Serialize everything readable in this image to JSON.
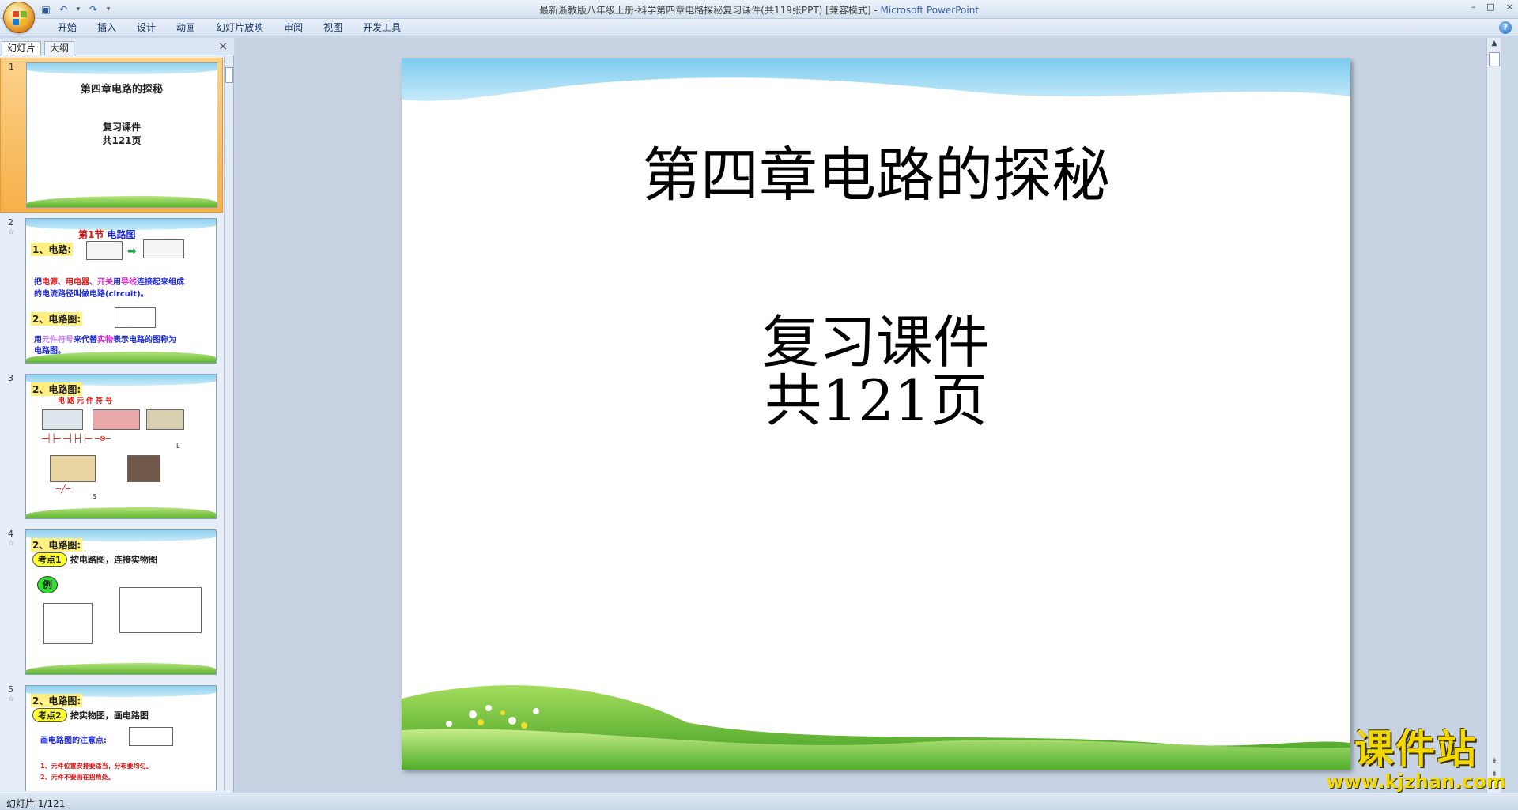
{
  "titlebar": {
    "title": "最新浙教版八年级上册-科学第四章电路探秘复习课件(共119张PPT) [兼容模式]",
    "app_name": "Microsoft PowerPoint",
    "window_controls": [
      "–",
      "□",
      "×"
    ]
  },
  "quick_access": {
    "icons": [
      "save-icon",
      "undo-icon",
      "redo-icon",
      "customize-icon"
    ]
  },
  "ribbon": {
    "tabs": [
      "开始",
      "插入",
      "设计",
      "动画",
      "幻灯片放映",
      "审阅",
      "视图",
      "开发工具"
    ],
    "help": "?"
  },
  "left_panel": {
    "tabs": [
      "幻灯片",
      "大纲"
    ],
    "close": "×"
  },
  "thumbnails": [
    {
      "num": "1",
      "lines": [
        "第四章电路的探秘",
        "复习课件",
        "共121页"
      ]
    },
    {
      "num": "2",
      "section": "第1节",
      "section_title": "电路图",
      "item1": "1、电路:",
      "def_parts": [
        "把",
        "电源",
        "、",
        "用电器",
        "、",
        "开关",
        "用",
        "导线",
        "连接起来组成"
      ],
      "def_line2": "的电流路径叫做电路(circuit)。",
      "item2": "2、电路图:",
      "desc_parts": [
        "用",
        "元件符号",
        "来代替",
        "实物",
        "表示电路的图称为"
      ],
      "desc_line2": "电路图。"
    },
    {
      "num": "3",
      "item": "2、电路图:",
      "subtitle": "电路元件符号",
      "label_l": "L",
      "label_s": "S"
    },
    {
      "num": "4",
      "item": "2、电路图:",
      "pill": "考点1",
      "pill_text": "按电路图，连接实物图",
      "example": "例"
    },
    {
      "num": "5",
      "item": "2、电路图:",
      "pill": "考点2",
      "pill_text": "按实物图，画电路图",
      "note": "画电路图的注意点:",
      "rule1": "1、元件位置安排要适当，分布要均匀。",
      "rule2": "2、元件不要画在拐角处。"
    }
  ],
  "slide": {
    "title": "第四章电路的探秘",
    "subtitle_1": "复习课件",
    "subtitle_2": "共121页"
  },
  "watermark": {
    "title": "课件站",
    "url": "www.kjzhan.com"
  },
  "status": {
    "slide_counter": "幻灯片 1/121"
  }
}
